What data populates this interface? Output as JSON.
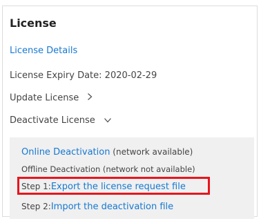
{
  "panel": {
    "title": "License",
    "details_link": "License Details",
    "expiry_text": "License Expiry Date: 2020-02-29",
    "update_label": "Update License",
    "deactivate_label": "Deactivate License"
  },
  "deactivation": {
    "online_link": "Online Deactivation",
    "online_note": " (network available)",
    "offline_text": "Offline Deactivation (network not available)",
    "step1_prefix": "Step 1:",
    "step1_link": "Export the license request file",
    "step2_prefix": "Step 2:",
    "step2_link": "Import the deactivation file"
  },
  "colors": {
    "link": "#1678d1",
    "highlight": "#e8141c",
    "subpanel_bg": "#f0f0f0"
  },
  "icons": {
    "update": "chevron-right-icon",
    "deactivate": "chevron-down-icon"
  }
}
